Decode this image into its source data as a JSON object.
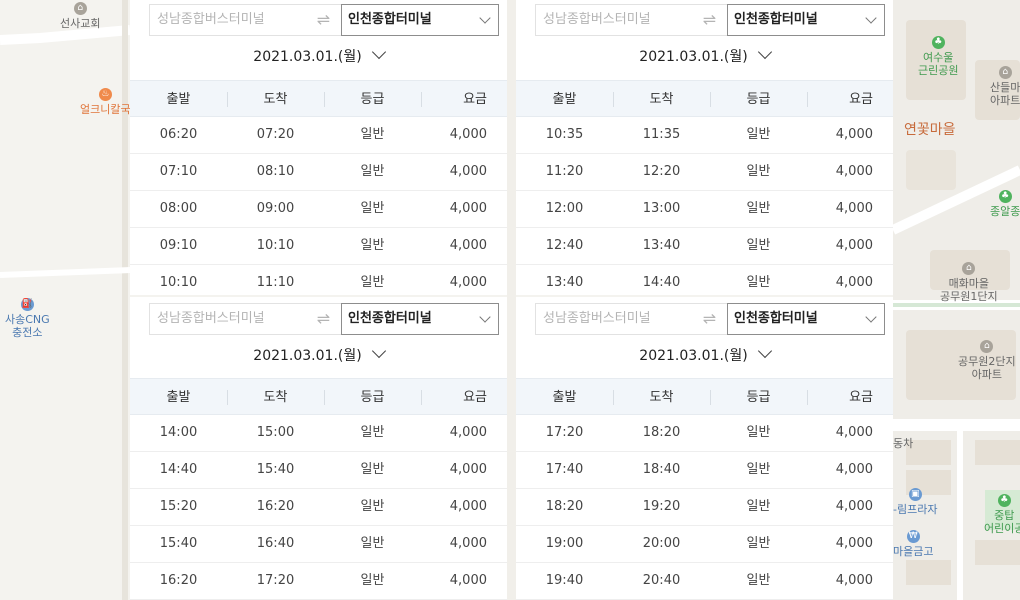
{
  "map": {
    "labels": {
      "seonsa_church": "선사교회",
      "restaurant": "얼크니칼국",
      "cng_station_1": "사송CNG",
      "cng_station_2": "충전소",
      "park_1": "여수울",
      "park_2": "근린공원",
      "apartment_1": "산들마",
      "apartment_1b": "아파트",
      "village": "연꽃마을",
      "station_cut": "종알종",
      "maehwa_1": "매화마을",
      "maehwa_2": "공무원1단지",
      "apt2_1": "공무원2단지",
      "apt2_2": "아파트",
      "bus_company": "동차",
      "plaza": "-림프라자",
      "bank": "마을금고",
      "school_1": "중탑",
      "school_2": "어린이공"
    }
  },
  "columns": [
    "출발",
    "도착",
    "등급",
    "요금"
  ],
  "panels": [
    {
      "from_placeholder": "성남종합버스터미널",
      "swap_icon": "⇌",
      "to": "인천종합터미널",
      "date": "2021.03.01.(월)",
      "rows": [
        [
          "06:20",
          "07:20",
          "일반",
          "4,000"
        ],
        [
          "07:10",
          "08:10",
          "일반",
          "4,000"
        ],
        [
          "08:00",
          "09:00",
          "일반",
          "4,000"
        ],
        [
          "09:10",
          "10:10",
          "일반",
          "4,000"
        ],
        [
          "10:10",
          "11:10",
          "일반",
          "4,000"
        ]
      ]
    },
    {
      "from_placeholder": "성남종합버스터미널",
      "swap_icon": "⇌",
      "to": "인천종합터미널",
      "date": "2021.03.01.(월)",
      "rows": [
        [
          "10:35",
          "11:35",
          "일반",
          "4,000"
        ],
        [
          "11:20",
          "12:20",
          "일반",
          "4,000"
        ],
        [
          "12:00",
          "13:00",
          "일반",
          "4,000"
        ],
        [
          "12:40",
          "13:40",
          "일반",
          "4,000"
        ],
        [
          "13:40",
          "14:40",
          "일반",
          "4,000"
        ]
      ]
    },
    {
      "from_placeholder": "성남종합버스터미널",
      "swap_icon": "⇌",
      "to": "인천종합터미널",
      "date": "2021.03.01.(월)",
      "rows": [
        [
          "14:00",
          "15:00",
          "일반",
          "4,000"
        ],
        [
          "14:40",
          "15:40",
          "일반",
          "4,000"
        ],
        [
          "15:20",
          "16:20",
          "일반",
          "4,000"
        ],
        [
          "15:40",
          "16:40",
          "일반",
          "4,000"
        ],
        [
          "16:20",
          "17:20",
          "일반",
          "4,000"
        ]
      ]
    },
    {
      "from_placeholder": "성남종합버스터미널",
      "swap_icon": "⇌",
      "to": "인천종합터미널",
      "date": "2021.03.01.(월)",
      "rows": [
        [
          "17:20",
          "18:20",
          "일반",
          "4,000"
        ],
        [
          "17:40",
          "18:40",
          "일반",
          "4,000"
        ],
        [
          "18:20",
          "19:20",
          "일반",
          "4,000"
        ],
        [
          "19:00",
          "20:00",
          "일반",
          "4,000"
        ],
        [
          "19:40",
          "20:40",
          "일반",
          "4,000"
        ]
      ]
    }
  ]
}
